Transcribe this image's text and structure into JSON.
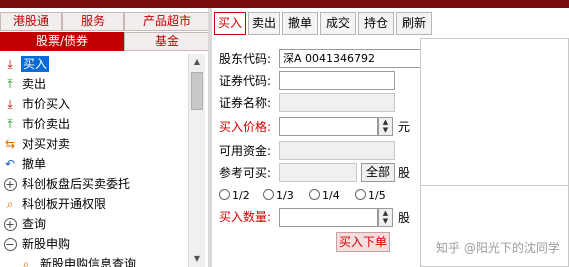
{
  "category_tabs": [
    {
      "label": "港股通",
      "active": false
    },
    {
      "label": "服务",
      "active": false
    },
    {
      "label": "产品超市",
      "active": false
    },
    {
      "label": "股票/债券",
      "active": true
    },
    {
      "label": "基金",
      "active": false
    }
  ],
  "menu": [
    {
      "icon": "buy-icon",
      "label": "买入",
      "selected": true
    },
    {
      "icon": "sell-icon",
      "label": "卖出",
      "selected": false
    },
    {
      "icon": "market-buy-icon",
      "label": "市价买入",
      "selected": false
    },
    {
      "icon": "market-sell-icon",
      "label": "市价卖出",
      "selected": false
    },
    {
      "icon": "swap-icon",
      "label": "对买对卖",
      "selected": false
    },
    {
      "icon": "cancel-order-icon",
      "label": "撤单",
      "selected": false
    },
    {
      "icon": "plus-circle-icon",
      "label": "科创板盘后买卖委托",
      "selected": false
    },
    {
      "icon": "search-icon",
      "label": "科创板开通权限",
      "selected": false
    },
    {
      "icon": "plus-circle-icon",
      "label": "查询",
      "selected": false
    },
    {
      "icon": "minus-circle-icon",
      "label": "新股申购",
      "selected": false
    },
    {
      "icon": "search-icon",
      "label": "新股申购信息查询",
      "selected": false
    }
  ],
  "toolbar": {
    "buy": "买入",
    "sell": "卖出",
    "cancel": "撤单",
    "deals": "成交",
    "positions": "持仓",
    "refresh": "刷新"
  },
  "form": {
    "shareholder_code_label": "股东代码:",
    "shareholder_code_value": "深A 0041346792",
    "security_code_label": "证券代码:",
    "security_code_value": "",
    "security_name_label": "证券名称:",
    "security_name_value": "",
    "buy_price_label": "买入价格:",
    "buy_price_value": "",
    "price_unit": "元",
    "available_funds_label": "可用资金:",
    "available_funds_value": "",
    "reference_buyable_label": "参考可买:",
    "reference_buyable_value": "",
    "all_button": "全部",
    "share_unit": "股",
    "fraction_options": [
      "1/2",
      "1/3",
      "1/4",
      "1/5"
    ],
    "buy_quantity_label": "买入数量:",
    "buy_quantity_value": "",
    "quantity_unit": "股",
    "submit_button": "买入下单"
  },
  "watermark": "知乎 @阳光下的沈同学",
  "colors": {
    "accent_red": "#c00000",
    "selection_blue": "#0a6ad6"
  }
}
